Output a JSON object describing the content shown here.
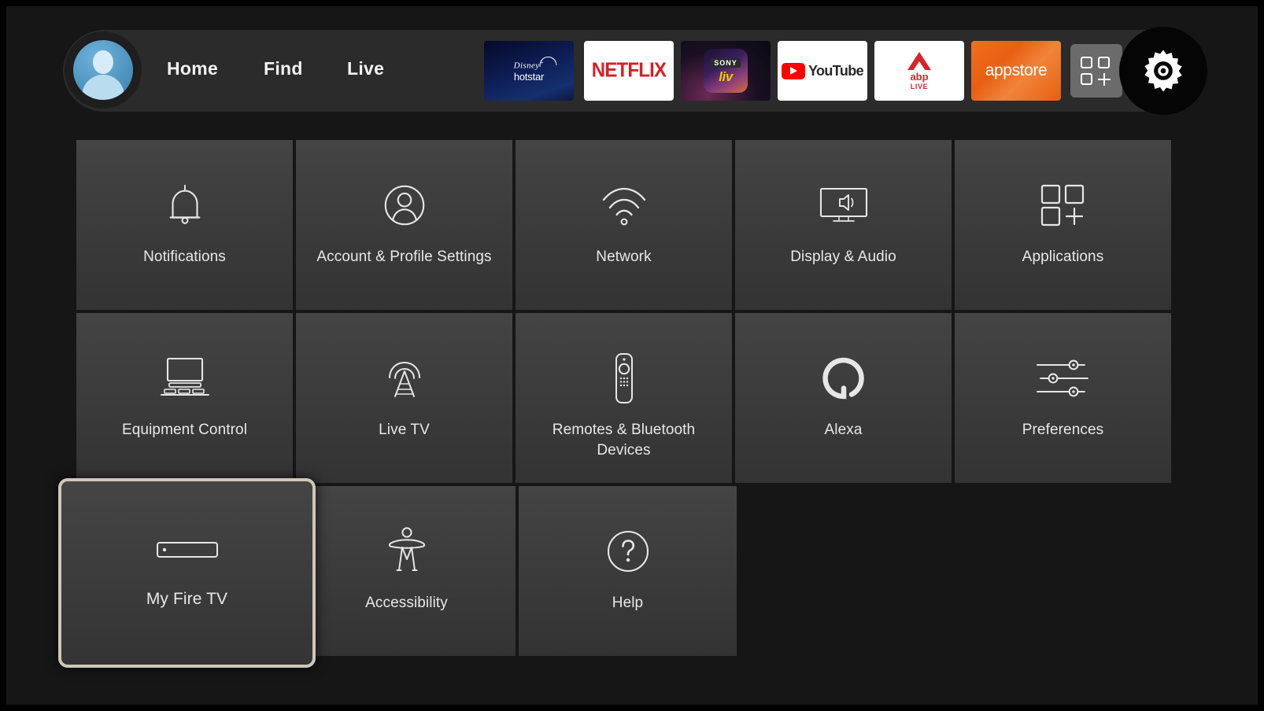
{
  "header": {
    "avatar": {
      "name": "profile-avatar"
    },
    "nav": [
      {
        "id": "home",
        "label": "Home"
      },
      {
        "id": "find",
        "label": "Find"
      },
      {
        "id": "live",
        "label": "Live"
      }
    ],
    "apps": [
      {
        "id": "hotstar",
        "name": "disney-hotstar-app-icon",
        "line1": "Disney",
        "plus": "+",
        "line2": "hotstar"
      },
      {
        "id": "netflix",
        "name": "netflix-app-icon",
        "label": "NETFLIX"
      },
      {
        "id": "sonyliv",
        "name": "sony-liv-app-icon",
        "brand": "SONY",
        "label": "liv"
      },
      {
        "id": "youtube",
        "name": "youtube-app-icon",
        "label": "YouTube"
      },
      {
        "id": "abplive",
        "name": "abp-live-app-icon",
        "label": "abp",
        "sub": "LIVE"
      },
      {
        "id": "appstore",
        "name": "appstore-app-icon",
        "label": "appstore"
      }
    ],
    "grid_button": {
      "name": "apps-grid-icon"
    },
    "settings_button": {
      "name": "gear-icon",
      "active": true
    }
  },
  "grid": {
    "rows": [
      [
        {
          "id": "notifications",
          "label": "Notifications",
          "icon": "bell-icon"
        },
        {
          "id": "account-profile-settings",
          "label": "Account & Profile Settings",
          "icon": "person-circle-icon"
        },
        {
          "id": "network",
          "label": "Network",
          "icon": "wifi-icon"
        },
        {
          "id": "display-audio",
          "label": "Display & Audio",
          "icon": "tv-speaker-icon"
        },
        {
          "id": "applications",
          "label": "Applications",
          "icon": "apps-grid-icon"
        }
      ],
      [
        {
          "id": "equipment-control",
          "label": "Equipment Control",
          "icon": "tv-equipment-icon"
        },
        {
          "id": "live-tv",
          "label": "Live TV",
          "icon": "broadcast-tower-icon"
        },
        {
          "id": "remotes-bluetooth-devices",
          "label": "Remotes & Bluetooth Devices",
          "icon": "remote-control-icon"
        },
        {
          "id": "alexa",
          "label": "Alexa",
          "icon": "alexa-ring-icon"
        },
        {
          "id": "preferences",
          "label": "Preferences",
          "icon": "sliders-icon"
        }
      ],
      [
        {
          "id": "accessibility",
          "label": "Accessibility",
          "icon": "accessibility-person-icon"
        },
        {
          "id": "help",
          "label": "Help",
          "icon": "question-circle-icon"
        }
      ]
    ],
    "selected": {
      "id": "my-fire-tv",
      "label": "My Fire TV",
      "icon": "fire-tv-stick-icon"
    }
  },
  "colors": {
    "background": "#161616",
    "tile": "#3c3c3c",
    "header_bar": "#2b2b2b",
    "selection_border": "#cfc7b8",
    "text": "#e8e8e8",
    "netflix_red": "#d81f26",
    "youtube_red": "#ff0000",
    "appstore_orange": "#e85f12",
    "abp_red": "#d6242b",
    "avatar_blue": "#4e93bf"
  }
}
